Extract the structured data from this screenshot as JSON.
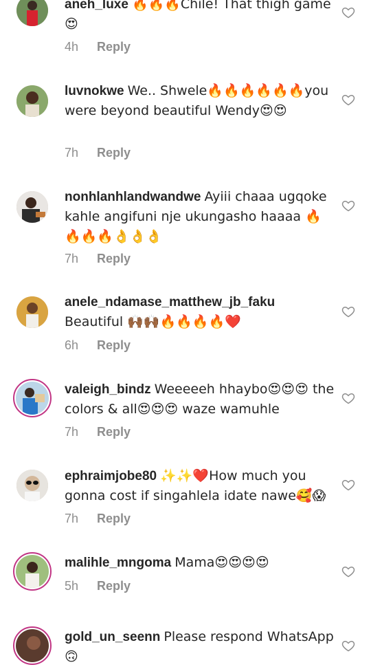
{
  "comments": [
    {
      "username": "aneh_luxe",
      "text": "🔥🔥🔥Chile! That thigh game 😍",
      "time": "4h",
      "reply": "Reply"
    },
    {
      "username": "luvnokwe",
      "text": "We.. Shwele🔥🔥🔥🔥🔥🔥you were beyond beautiful Wendy😍😍",
      "time": "7h",
      "reply": "Reply"
    },
    {
      "username": "nonhlanhlandwandwe",
      "text": "Ayiii chaaa ugqoke kahle angifuni nje ukungasho haaaa 🔥🔥🔥🔥👌👌👌",
      "time": "7h",
      "reply": "Reply"
    },
    {
      "username": "anele_ndamase_matthew_jb_faku",
      "text": "Beautiful 🙌🏾🙌🏾🔥🔥🔥🔥❤️",
      "time": "6h",
      "reply": "Reply"
    },
    {
      "username": "valeigh_bindz",
      "text": "Weeeeeh hhaybo😍😍😍 the colors & all😍😍😍 waze wamuhle",
      "time": "7h",
      "reply": "Reply"
    },
    {
      "username": "ephraimjobe80",
      "text": "✨✨❤️How much you gonna cost if singahlela idate nawe🥰😱",
      "time": "7h",
      "reply": "Reply"
    },
    {
      "username": "malihle_mngoma",
      "text": "Mama😍😍😍😍",
      "time": "5h",
      "reply": "Reply"
    },
    {
      "username": "gold_un_seenn",
      "text": "Please respond WhatsApp 🙃",
      "time": "",
      "reply": ""
    }
  ]
}
